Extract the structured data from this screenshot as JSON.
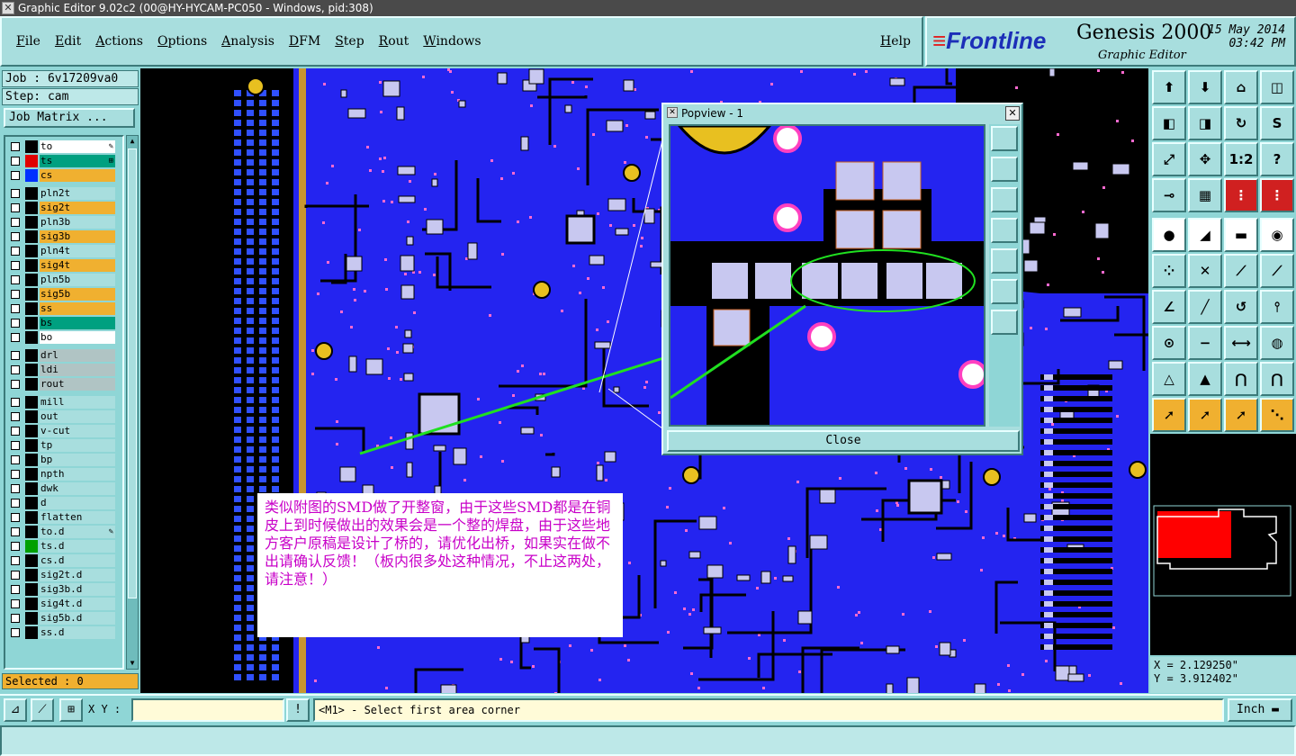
{
  "window": {
    "title": "Graphic Editor 9.02c2 (00@HY-HYCAM-PC050 - Windows, pid:308)"
  },
  "menu": [
    {
      "label": "File"
    },
    {
      "label": "Edit"
    },
    {
      "label": "Actions"
    },
    {
      "label": "Options"
    },
    {
      "label": "Analysis"
    },
    {
      "label": "DFM"
    },
    {
      "label": "Step"
    },
    {
      "label": "Rout"
    },
    {
      "label": "Windows"
    }
  ],
  "help_label": "Help",
  "brand": {
    "logo": "Frontline",
    "product": "Genesis 2000",
    "subtitle": "Graphic Editor",
    "date": "15 May 2014",
    "time": "03:42 PM"
  },
  "job": {
    "job_label": "Job : 6v17209va0",
    "step_label": "Step: cam",
    "matrix_button": "Job Matrix ..."
  },
  "colors": {
    "orange": "#f0b030",
    "green": "#00a080",
    "white": "#ffffff",
    "gray": "#b0c4c4",
    "cyan": "#a8dede",
    "board_blue": "#2424f0",
    "pad": "#c8c8f0"
  },
  "layers": [
    {
      "name": "to",
      "fill": "white",
      "color": "#000000",
      "mark": "✎"
    },
    {
      "name": "ts",
      "fill": "green",
      "color": "#e00000",
      "mark": "⊞"
    },
    {
      "name": "cs",
      "fill": "orange",
      "color": "#0030ff",
      "mark": ""
    },
    {
      "name": "pln2t",
      "fill": "cyan",
      "color": "#000000",
      "mark": ""
    },
    {
      "name": "sig2t",
      "fill": "orange",
      "color": "#000000",
      "mark": ""
    },
    {
      "name": "pln3b",
      "fill": "cyan",
      "color": "#000000",
      "mark": ""
    },
    {
      "name": "sig3b",
      "fill": "orange",
      "color": "#000000",
      "mark": ""
    },
    {
      "name": "pln4t",
      "fill": "cyan",
      "color": "#000000",
      "mark": ""
    },
    {
      "name": "sig4t",
      "fill": "orange",
      "color": "#000000",
      "mark": ""
    },
    {
      "name": "pln5b",
      "fill": "cyan",
      "color": "#000000",
      "mark": ""
    },
    {
      "name": "sig5b",
      "fill": "orange",
      "color": "#000000",
      "mark": ""
    },
    {
      "name": "ss",
      "fill": "orange",
      "color": "#000000",
      "mark": ""
    },
    {
      "name": "bs",
      "fill": "green",
      "color": "#000000",
      "mark": ""
    },
    {
      "name": "bo",
      "fill": "white",
      "color": "#000000",
      "mark": ""
    },
    {
      "name": "drl",
      "fill": "gray",
      "color": "#000000",
      "mark": ""
    },
    {
      "name": "ldi",
      "fill": "gray",
      "color": "#000000",
      "mark": ""
    },
    {
      "name": "rout",
      "fill": "gray",
      "color": "#000000",
      "mark": ""
    },
    {
      "name": "mill",
      "fill": "cyan",
      "color": "#000000",
      "mark": ""
    },
    {
      "name": "out",
      "fill": "cyan",
      "color": "#000000",
      "mark": ""
    },
    {
      "name": "v-cut",
      "fill": "cyan",
      "color": "#000000",
      "mark": ""
    },
    {
      "name": "tp",
      "fill": "cyan",
      "color": "#000000",
      "mark": ""
    },
    {
      "name": "bp",
      "fill": "cyan",
      "color": "#000000",
      "mark": ""
    },
    {
      "name": "npth",
      "fill": "cyan",
      "color": "#000000",
      "mark": ""
    },
    {
      "name": "dwk",
      "fill": "cyan",
      "color": "#000000",
      "mark": ""
    },
    {
      "name": "d",
      "fill": "cyan",
      "color": "#000000",
      "mark": ""
    },
    {
      "name": "flatten",
      "fill": "cyan",
      "color": "#000000",
      "mark": ""
    },
    {
      "name": "to.d",
      "fill": "cyan",
      "color": "#000000",
      "mark": "✎"
    },
    {
      "name": "ts.d",
      "fill": "cyan",
      "color": "#00a000",
      "mark": ""
    },
    {
      "name": "cs.d",
      "fill": "cyan",
      "color": "#000000",
      "mark": ""
    },
    {
      "name": "sig2t.d",
      "fill": "cyan",
      "color": "#000000",
      "mark": ""
    },
    {
      "name": "sig3b.d",
      "fill": "cyan",
      "color": "#000000",
      "mark": ""
    },
    {
      "name": "sig4t.d",
      "fill": "cyan",
      "color": "#000000",
      "mark": ""
    },
    {
      "name": "sig5b.d",
      "fill": "cyan",
      "color": "#000000",
      "mark": ""
    },
    {
      "name": "ss.d",
      "fill": "cyan",
      "color": "#000000",
      "mark": ""
    }
  ],
  "selected_label": "Selected : 0",
  "note_text": "类似附图的SMD做了开整窗，由于这些SMD都是在铜皮上到时候做出的效果会是一个整的焊盘，由于这些地方客户原稿是设计了桥的，请优化出桥，如果实在做不出请确认反馈！（板内很多处这种情况，不止这两处，请注意！）",
  "popview": {
    "title": "Popview - 1",
    "close_button": "Close"
  },
  "tools": [
    {
      "name": "layer-up-icon",
      "glyph": "⬆",
      "style": ""
    },
    {
      "name": "layer-down-icon",
      "glyph": "⬇",
      "style": ""
    },
    {
      "name": "home-icon",
      "glyph": "⌂",
      "style": ""
    },
    {
      "name": "window-split-icon",
      "glyph": "◫",
      "style": ""
    },
    {
      "name": "pan-left-icon",
      "glyph": "◧",
      "style": ""
    },
    {
      "name": "pan-right-icon",
      "glyph": "◨",
      "style": ""
    },
    {
      "name": "redraw-icon",
      "glyph": "↻",
      "style": ""
    },
    {
      "name": "snake-icon",
      "glyph": "S",
      "style": ""
    },
    {
      "name": "zoom-fit-icon",
      "glyph": "⤢",
      "style": ""
    },
    {
      "name": "zoom-center-icon",
      "glyph": "✥",
      "style": ""
    },
    {
      "name": "zoom-1to1-icon",
      "glyph": "1:2",
      "style": ""
    },
    {
      "name": "query-icon",
      "glyph": "?",
      "style": ""
    },
    {
      "name": "measure-icon",
      "glyph": "⊸",
      "style": ""
    },
    {
      "name": "grid-icon",
      "glyph": "▦",
      "style": ""
    },
    {
      "name": "snap-icon",
      "glyph": "⋮",
      "style": "red"
    },
    {
      "name": "snap2-icon",
      "glyph": "⋮",
      "style": "red"
    },
    {
      "name": "add-pad-icon",
      "glyph": "●",
      "style": "white"
    },
    {
      "name": "add-line-icon",
      "glyph": "◢",
      "style": "white"
    },
    {
      "name": "ruler-icon",
      "glyph": "▬",
      "style": "white"
    },
    {
      "name": "circle-select-icon",
      "glyph": "◉",
      "style": "white"
    },
    {
      "name": "net-icon",
      "glyph": "⁘",
      "style": ""
    },
    {
      "name": "cross-icon",
      "glyph": "✕",
      "style": ""
    },
    {
      "name": "connect-icon",
      "glyph": "⟋",
      "style": ""
    },
    {
      "name": "connect2-icon",
      "glyph": "⟋",
      "style": ""
    },
    {
      "name": "angle-icon",
      "glyph": "∠",
      "style": ""
    },
    {
      "name": "slash-icon",
      "glyph": "╱",
      "style": ""
    },
    {
      "name": "arc-icon",
      "glyph": "↺",
      "style": ""
    },
    {
      "name": "fork-icon",
      "glyph": "⫯",
      "style": ""
    },
    {
      "name": "pad-line-icon",
      "glyph": "⊙",
      "style": ""
    },
    {
      "name": "minus-icon",
      "glyph": "−",
      "style": ""
    },
    {
      "name": "resize-icon",
      "glyph": "⟷",
      "style": ""
    },
    {
      "name": "group-icon",
      "glyph": "◍",
      "style": ""
    },
    {
      "name": "triangle-icon",
      "glyph": "△",
      "style": ""
    },
    {
      "name": "triangle2-icon",
      "glyph": "▲",
      "style": ""
    },
    {
      "name": "arch-icon",
      "glyph": "⋂",
      "style": ""
    },
    {
      "name": "arch2-icon",
      "glyph": "⋂",
      "style": ""
    },
    {
      "name": "pointer-icon",
      "glyph": "➚",
      "style": "orange"
    },
    {
      "name": "pointer-box-icon",
      "glyph": "➚",
      "style": "orange"
    },
    {
      "name": "pointer-select-icon",
      "glyph": "➚",
      "style": "orange"
    },
    {
      "name": "pointer-net-icon",
      "glyph": "⋱",
      "style": "orange"
    }
  ],
  "coords": {
    "x": "X = 2.129250\"",
    "y": "Y = 3.912402\""
  },
  "status": {
    "xy_label": "X Y :",
    "xy_value": "",
    "prompt": "<M1> - Select first area corner",
    "unit": "Inch"
  }
}
